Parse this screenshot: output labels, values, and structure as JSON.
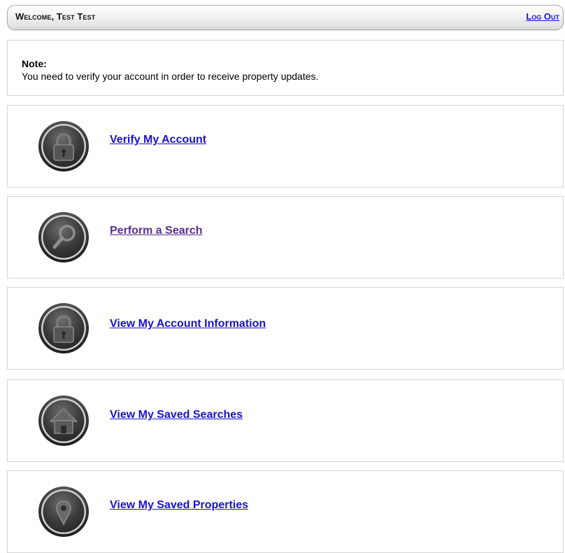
{
  "header": {
    "welcome_text": "Welcome, Test Test",
    "logout_label": "Log Out"
  },
  "note": {
    "title": "Note:",
    "message": "You need to verify your account in order to receive property updates."
  },
  "actions": [
    {
      "label": "Verify My Account",
      "icon": "lock-icon",
      "visited": false
    },
    {
      "label": "Perform a Search",
      "icon": "magnifier-icon",
      "visited": true
    },
    {
      "label": "View My Account Information",
      "icon": "lock-icon",
      "visited": false
    },
    {
      "label": "View My Saved Searches",
      "icon": "home-icon",
      "visited": false
    },
    {
      "label": "View My Saved Properties",
      "icon": "map-pin-icon",
      "visited": false
    }
  ],
  "colors": {
    "link": "#1a12c9",
    "visited_link": "#5b2c8c",
    "card_border": "#d4d4d4",
    "icon_dark": "#3a3a3a"
  }
}
